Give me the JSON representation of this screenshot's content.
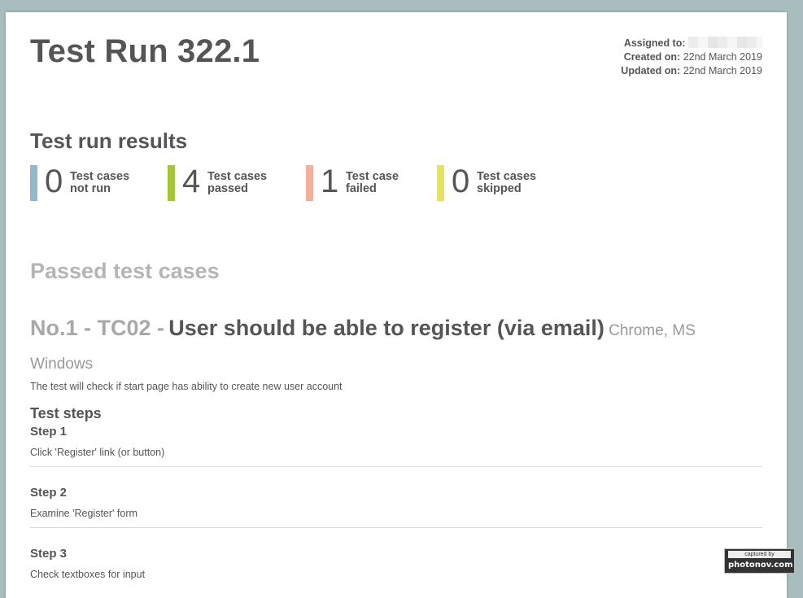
{
  "header": {
    "title": "Test Run 322.1",
    "assigned_label": "Assigned to:",
    "created_label": "Created on:",
    "created_value": "22nd March 2019",
    "updated_label": "Updated on:",
    "updated_value": "22nd March 2019"
  },
  "results": {
    "title": "Test run results",
    "stats": [
      {
        "count": "0",
        "label_line1": "Test cases",
        "label_line2": "not run",
        "color": "#93b8c9"
      },
      {
        "count": "4",
        "label_line1": "Test cases",
        "label_line2": "passed",
        "color": "#a4c43a"
      },
      {
        "count": "1",
        "label_line1": "Test case",
        "label_line2": "failed",
        "color": "#f3b19d"
      },
      {
        "count": "0",
        "label_line1": "Test cases",
        "label_line2": "skipped",
        "color": "#e7e35a"
      }
    ]
  },
  "passed": {
    "title": "Passed test cases",
    "test_case": {
      "number": "No.1 - TC02 -",
      "name": "User should be able to register (via email)",
      "environment": "Chrome, MS Windows",
      "description": "The test will check if start page has ability to create new user account",
      "steps_title": "Test steps",
      "steps": [
        {
          "name": "Step 1",
          "text": "Click 'Register' link (or button)"
        },
        {
          "name": "Step 2",
          "text": "Examine 'Register' form"
        },
        {
          "name": "Step 3",
          "text": "Check textboxes for input"
        }
      ]
    }
  },
  "watermark": {
    "line1": "captured by",
    "line2": "photonov.com"
  }
}
